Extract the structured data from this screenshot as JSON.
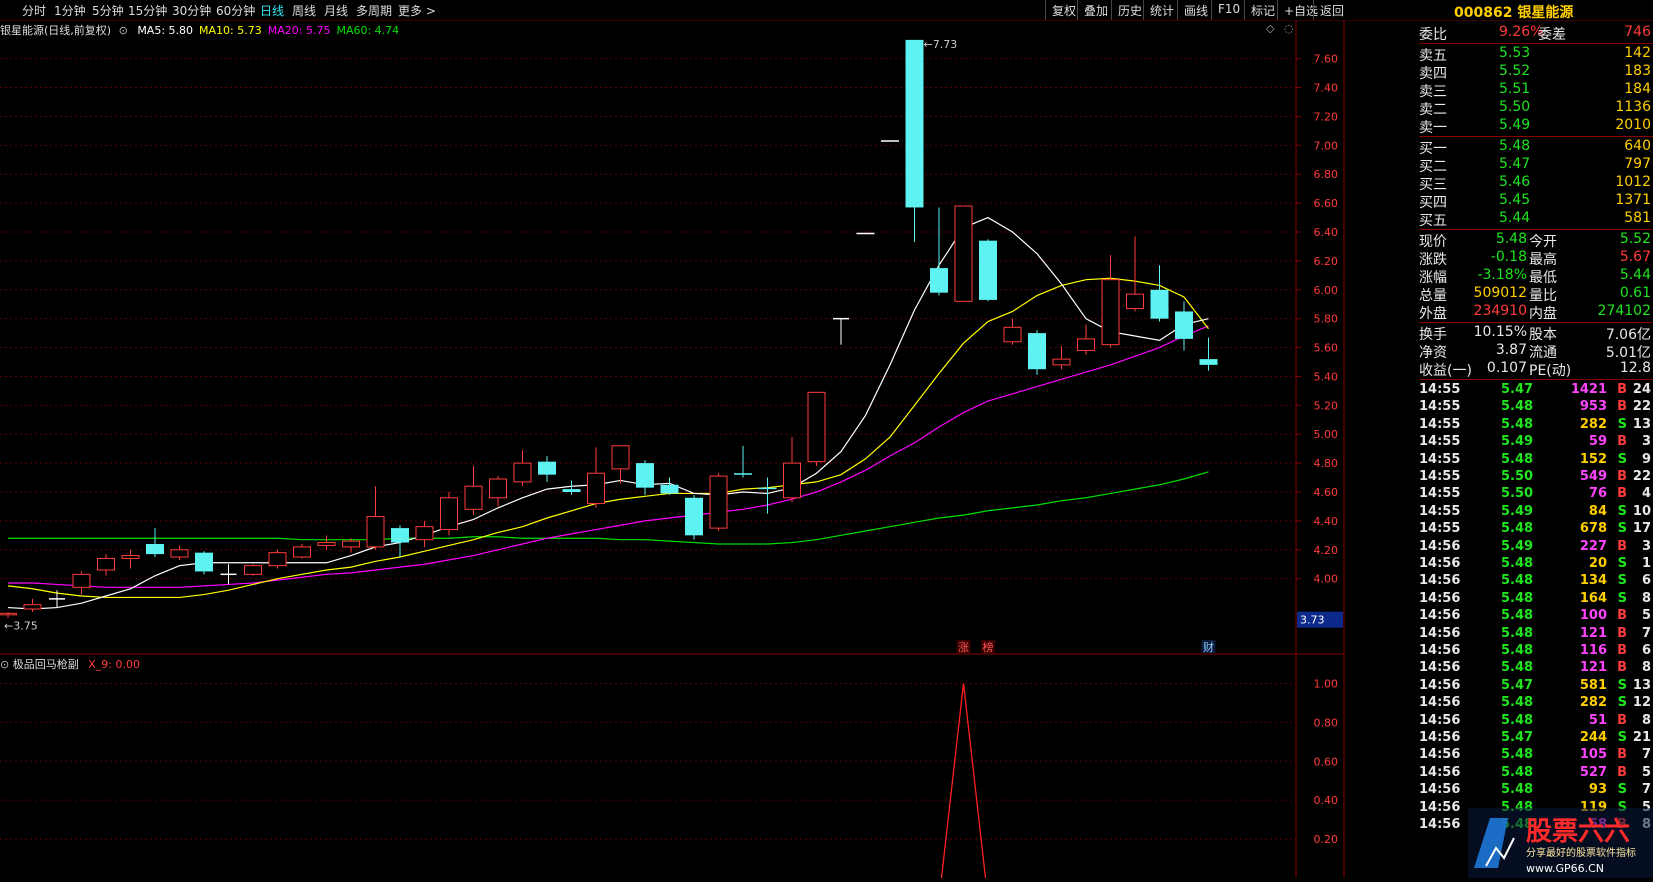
{
  "toolbar": {
    "periods": [
      "分时",
      "1分钟",
      "5分钟",
      "15分钟",
      "30分钟",
      "60分钟",
      "日线",
      "周线",
      "月线",
      "多周期",
      "更多 >"
    ],
    "active_period": "日线",
    "right_buttons": [
      "复权",
      "叠加",
      "历史",
      "统计",
      "画线",
      "F10",
      "标记",
      "+自选",
      "返回"
    ]
  },
  "stock": {
    "code": "000862",
    "name": "银星能源",
    "header": "000862 银星能源"
  },
  "main_chart": {
    "legend_name": "银星能源(日线,前复权)",
    "ma": [
      {
        "label": "MA5: 5.80",
        "color": "#ffffff"
      },
      {
        "label": "MA10: 5.73",
        "color": "#ffff00"
      },
      {
        "label": "MA20: 5.75",
        "color": "#ff00ff"
      },
      {
        "label": "MA60: 4.74",
        "color": "#00e000"
      }
    ],
    "high_label": "7.73",
    "low_label": "3.75",
    "price_tag": "3.73",
    "markers": [
      "涨",
      "榜",
      "财"
    ]
  },
  "sub_chart": {
    "legend_name": "极品回马枪副",
    "legend_value": "X_9: 0.00"
  },
  "chart_data": [
    {
      "type": "candlestick",
      "ylim": [
        3.7,
        7.75
      ],
      "yticks": [
        "7.60",
        "7.40",
        "7.20",
        "7.00",
        "6.80",
        "6.60",
        "6.40",
        "6.20",
        "6.00",
        "5.80",
        "5.60",
        "5.40",
        "5.20",
        "5.00",
        "4.80",
        "4.60",
        "4.40",
        "4.20",
        "4.00"
      ],
      "candles": [
        {
          "o": 3.75,
          "c": 3.76,
          "h": 3.77,
          "l": 3.73
        },
        {
          "o": 3.79,
          "c": 3.82,
          "h": 3.86,
          "l": 3.77
        },
        {
          "o": 3.86,
          "c": 3.86,
          "h": 3.92,
          "l": 3.8
        },
        {
          "o": 3.94,
          "c": 4.03,
          "h": 4.05,
          "l": 3.89
        },
        {
          "o": 4.06,
          "c": 4.14,
          "h": 4.17,
          "l": 4.02
        },
        {
          "o": 4.14,
          "c": 4.16,
          "h": 4.2,
          "l": 4.07
        },
        {
          "o": 4.24,
          "c": 4.17,
          "h": 4.35,
          "l": 4.15
        },
        {
          "o": 4.15,
          "c": 4.2,
          "h": 4.23,
          "l": 4.13
        },
        {
          "o": 4.18,
          "c": 4.05,
          "h": 4.19,
          "l": 4.03
        },
        {
          "o": 4.03,
          "c": 4.03,
          "h": 4.1,
          "l": 3.96
        },
        {
          "o": 4.03,
          "c": 4.09,
          "h": 4.1,
          "l": 4.02
        },
        {
          "o": 4.09,
          "c": 4.18,
          "h": 4.2,
          "l": 4.07
        },
        {
          "o": 4.15,
          "c": 4.22,
          "h": 4.24,
          "l": 4.14
        },
        {
          "o": 4.23,
          "c": 4.25,
          "h": 4.3,
          "l": 4.2
        },
        {
          "o": 4.22,
          "c": 4.26,
          "h": 4.28,
          "l": 4.18
        },
        {
          "o": 4.22,
          "c": 4.43,
          "h": 4.64,
          "l": 4.2
        },
        {
          "o": 4.35,
          "c": 4.25,
          "h": 4.37,
          "l": 4.15
        },
        {
          "o": 4.27,
          "c": 4.36,
          "h": 4.4,
          "l": 4.22
        },
        {
          "o": 4.34,
          "c": 4.56,
          "h": 4.6,
          "l": 4.3
        },
        {
          "o": 4.48,
          "c": 4.64,
          "h": 4.78,
          "l": 4.44
        },
        {
          "o": 4.56,
          "c": 4.69,
          "h": 4.71,
          "l": 4.5
        },
        {
          "o": 4.67,
          "c": 4.8,
          "h": 4.89,
          "l": 4.64
        },
        {
          "o": 4.81,
          "c": 4.72,
          "h": 4.85,
          "l": 4.67
        },
        {
          "o": 4.62,
          "c": 4.6,
          "h": 4.68,
          "l": 4.58
        },
        {
          "o": 4.52,
          "c": 4.73,
          "h": 4.91,
          "l": 4.49
        },
        {
          "o": 4.76,
          "c": 4.92,
          "h": 4.92,
          "l": 4.66
        },
        {
          "o": 4.8,
          "c": 4.63,
          "h": 4.82,
          "l": 4.58
        },
        {
          "o": 4.65,
          "c": 4.59,
          "h": 4.7,
          "l": 4.58
        },
        {
          "o": 4.56,
          "c": 4.3,
          "h": 4.58,
          "l": 4.27
        },
        {
          "o": 4.35,
          "c": 4.71,
          "h": 4.73,
          "l": 4.33
        },
        {
          "o": 4.73,
          "c": 4.72,
          "h": 4.92,
          "l": 4.7
        },
        {
          "o": 4.63,
          "c": 4.62,
          "h": 4.7,
          "l": 4.45
        },
        {
          "o": 4.56,
          "c": 4.8,
          "h": 4.98,
          "l": 4.53
        },
        {
          "o": 4.81,
          "c": 5.29,
          "h": 5.29,
          "l": 4.78
        },
        {
          "o": 5.8,
          "c": 5.8,
          "h": 5.8,
          "l": 5.62
        },
        {
          "o": 6.39,
          "c": 6.39,
          "h": 6.39,
          "l": 6.39
        },
        {
          "o": 7.03,
          "c": 7.03,
          "h": 7.03,
          "l": 7.03
        },
        {
          "o": 7.73,
          "c": 6.57,
          "h": 7.73,
          "l": 6.33
        },
        {
          "o": 6.15,
          "c": 5.98,
          "h": 6.57,
          "l": 5.96
        },
        {
          "o": 5.92,
          "c": 6.58,
          "h": 6.58,
          "l": 5.92
        },
        {
          "o": 6.34,
          "c": 5.93,
          "h": 6.35,
          "l": 5.92
        },
        {
          "o": 5.64,
          "c": 5.74,
          "h": 5.8,
          "l": 5.62
        },
        {
          "o": 5.7,
          "c": 5.45,
          "h": 5.72,
          "l": 5.41
        },
        {
          "o": 5.48,
          "c": 5.52,
          "h": 5.61,
          "l": 5.45
        },
        {
          "o": 5.58,
          "c": 5.66,
          "h": 5.76,
          "l": 5.55
        },
        {
          "o": 5.62,
          "c": 6.07,
          "h": 6.24,
          "l": 5.6
        },
        {
          "o": 5.87,
          "c": 5.97,
          "h": 6.37,
          "l": 5.85
        },
        {
          "o": 6.0,
          "c": 5.8,
          "h": 6.17,
          "l": 5.78
        },
        {
          "o": 5.85,
          "c": 5.66,
          "h": 5.92,
          "l": 5.58
        },
        {
          "o": 5.52,
          "c": 5.48,
          "h": 5.67,
          "l": 5.44
        }
      ],
      "ma5": [
        3.8,
        3.79,
        3.8,
        3.83,
        3.88,
        3.93,
        4.02,
        4.09,
        4.11,
        4.11,
        4.11,
        4.11,
        4.11,
        4.11,
        4.16,
        4.22,
        4.25,
        4.3,
        4.36,
        4.41,
        4.49,
        4.56,
        4.62,
        4.64,
        4.65,
        4.68,
        4.65,
        4.66,
        4.59,
        4.58,
        4.6,
        4.59,
        4.63,
        4.73,
        4.88,
        5.13,
        5.48,
        5.86,
        6.17,
        6.43,
        6.5,
        6.4,
        6.25,
        6.04,
        5.8,
        5.71,
        5.68,
        5.65,
        5.76,
        5.8
      ],
      "ma10": [
        3.95,
        3.93,
        3.9,
        3.88,
        3.87,
        3.87,
        3.87,
        3.87,
        3.89,
        3.92,
        3.96,
        4.0,
        4.03,
        4.06,
        4.08,
        4.12,
        4.15,
        4.19,
        4.23,
        4.27,
        4.32,
        4.36,
        4.42,
        4.47,
        4.52,
        4.55,
        4.57,
        4.59,
        4.59,
        4.59,
        4.62,
        4.63,
        4.65,
        4.67,
        4.72,
        4.83,
        4.98,
        5.2,
        5.42,
        5.63,
        5.78,
        5.85,
        5.96,
        6.03,
        6.07,
        6.08,
        6.06,
        6.03,
        5.95,
        5.73
      ],
      "ma20": [
        3.97,
        3.97,
        3.96,
        3.95,
        3.94,
        3.94,
        3.94,
        3.94,
        3.95,
        3.96,
        3.97,
        3.99,
        4.01,
        4.03,
        4.04,
        4.06,
        4.08,
        4.1,
        4.13,
        4.16,
        4.2,
        4.24,
        4.28,
        4.31,
        4.34,
        4.37,
        4.4,
        4.42,
        4.44,
        4.46,
        4.48,
        4.51,
        4.55,
        4.6,
        4.67,
        4.75,
        4.85,
        4.94,
        5.05,
        5.15,
        5.23,
        5.28,
        5.33,
        5.38,
        5.43,
        5.48,
        5.54,
        5.6,
        5.68,
        5.75
      ],
      "ma60": [
        4.28,
        4.28,
        4.28,
        4.28,
        4.28,
        4.28,
        4.28,
        4.28,
        4.28,
        4.28,
        4.28,
        4.28,
        4.27,
        4.27,
        4.27,
        4.27,
        4.28,
        4.28,
        4.28,
        4.29,
        4.29,
        4.28,
        4.28,
        4.28,
        4.28,
        4.27,
        4.27,
        4.26,
        4.25,
        4.24,
        4.24,
        4.24,
        4.25,
        4.27,
        4.3,
        4.33,
        4.36,
        4.39,
        4.42,
        4.44,
        4.47,
        4.49,
        4.51,
        4.54,
        4.56,
        4.59,
        4.62,
        4.65,
        4.69,
        4.74
      ]
    },
    {
      "type": "line",
      "ylim": [
        0,
        1.1
      ],
      "yticks": [
        "1.00",
        "0.80",
        "0.60",
        "0.40",
        "0.20"
      ],
      "spike_index": 39,
      "spike_value": 1.0
    }
  ],
  "quote_panel": {
    "weibi": {
      "label": "委比",
      "value": "9.26%",
      "label2": "委差",
      "value2": "746"
    },
    "asks": [
      {
        "label": "卖五",
        "price": "5.53",
        "vol": "142"
      },
      {
        "label": "卖四",
        "price": "5.52",
        "vol": "183"
      },
      {
        "label": "卖三",
        "price": "5.51",
        "vol": "184"
      },
      {
        "label": "卖二",
        "price": "5.50",
        "vol": "1136"
      },
      {
        "label": "卖一",
        "price": "5.49",
        "vol": "2010"
      }
    ],
    "bids": [
      {
        "label": "买一",
        "price": "5.48",
        "vol": "640"
      },
      {
        "label": "买二",
        "price": "5.47",
        "vol": "797"
      },
      {
        "label": "买三",
        "price": "5.46",
        "vol": "1012"
      },
      {
        "label": "买四",
        "price": "5.45",
        "vol": "1371"
      },
      {
        "label": "买五",
        "price": "5.44",
        "vol": "581"
      }
    ],
    "stats": [
      {
        "l1": "现价",
        "v1": "5.48",
        "c1": "#1fe51f",
        "l2": "今开",
        "v2": "5.52",
        "c2": "#1fe51f"
      },
      {
        "l1": "涨跌",
        "v1": "-0.18",
        "c1": "#1fe51f",
        "l2": "最高",
        "v2": "5.67",
        "c2": "#ff3b3b"
      },
      {
        "l1": "涨幅",
        "v1": "-3.18%",
        "c1": "#1fe51f",
        "l2": "最低",
        "v2": "5.44",
        "c2": "#1fe51f"
      },
      {
        "l1": "总量",
        "v1": "509012",
        "c1": "#ffcf00",
        "l2": "量比",
        "v2": "0.61",
        "c2": "#1fe51f"
      },
      {
        "l1": "外盘",
        "v1": "234910",
        "c1": "#ff3b3b",
        "l2": "内盘",
        "v2": "274102",
        "c2": "#1fe51f"
      }
    ],
    "stats2": [
      {
        "l1": "换手",
        "v1": "10.15%",
        "l2": "股本",
        "v2": "7.06亿"
      },
      {
        "l1": "净资",
        "v1": "3.87",
        "l2": "流通",
        "v2": "5.01亿"
      },
      {
        "l1": "收益(一)",
        "v1": "0.107",
        "l2": "PE(动)",
        "v2": "12.8"
      }
    ],
    "trades": [
      {
        "t": "14:55",
        "p": "5.47",
        "v": "1421",
        "d": "B",
        "n": "24"
      },
      {
        "t": "14:55",
        "p": "5.48",
        "v": "953",
        "d": "B",
        "n": "22"
      },
      {
        "t": "14:55",
        "p": "5.48",
        "v": "282",
        "d": "S",
        "n": "13"
      },
      {
        "t": "14:55",
        "p": "5.49",
        "v": "59",
        "d": "B",
        "n": "3"
      },
      {
        "t": "14:55",
        "p": "5.48",
        "v": "152",
        "d": "S",
        "n": "9"
      },
      {
        "t": "14:55",
        "p": "5.50",
        "v": "549",
        "d": "B",
        "n": "22"
      },
      {
        "t": "14:55",
        "p": "5.50",
        "v": "76",
        "d": "B",
        "n": "4"
      },
      {
        "t": "14:55",
        "p": "5.49",
        "v": "84",
        "d": "S",
        "n": "10"
      },
      {
        "t": "14:55",
        "p": "5.48",
        "v": "678",
        "d": "S",
        "n": "17"
      },
      {
        "t": "14:56",
        "p": "5.49",
        "v": "227",
        "d": "B",
        "n": "3"
      },
      {
        "t": "14:56",
        "p": "5.48",
        "v": "20",
        "d": "S",
        "n": "1"
      },
      {
        "t": "14:56",
        "p": "5.48",
        "v": "134",
        "d": "S",
        "n": "6"
      },
      {
        "t": "14:56",
        "p": "5.48",
        "v": "164",
        "d": "S",
        "n": "8"
      },
      {
        "t": "14:56",
        "p": "5.48",
        "v": "100",
        "d": "B",
        "n": "5"
      },
      {
        "t": "14:56",
        "p": "5.48",
        "v": "121",
        "d": "B",
        "n": "7"
      },
      {
        "t": "14:56",
        "p": "5.48",
        "v": "116",
        "d": "B",
        "n": "6"
      },
      {
        "t": "14:56",
        "p": "5.48",
        "v": "121",
        "d": "B",
        "n": "8"
      },
      {
        "t": "14:56",
        "p": "5.47",
        "v": "581",
        "d": "S",
        "n": "13"
      },
      {
        "t": "14:56",
        "p": "5.48",
        "v": "282",
        "d": "S",
        "n": "12"
      },
      {
        "t": "14:56",
        "p": "5.48",
        "v": "51",
        "d": "B",
        "n": "8"
      },
      {
        "t": "14:56",
        "p": "5.47",
        "v": "244",
        "d": "S",
        "n": "21"
      },
      {
        "t": "14:56",
        "p": "5.48",
        "v": "105",
        "d": "B",
        "n": "7"
      },
      {
        "t": "14:56",
        "p": "5.48",
        "v": "527",
        "d": "B",
        "n": "5"
      },
      {
        "t": "14:56",
        "p": "5.48",
        "v": "93",
        "d": "S",
        "n": "7"
      },
      {
        "t": "14:56",
        "p": "5.48",
        "v": "119",
        "d": "S",
        "n": "5"
      },
      {
        "t": "14:56",
        "p": "5.48",
        "v": "68",
        "d": "B",
        "n": "8"
      }
    ]
  },
  "watermark": {
    "title": "股票六六",
    "subtitle": "分享最好的股票软件指标",
    "url": "www.GP66.CN"
  },
  "colors": {
    "up": "#ff3b3b",
    "down": "#5ef2f2",
    "bg": "#000000",
    "grid": "#5a0000",
    "ma5": "#ffffff",
    "ma10": "#ffff00",
    "ma20": "#ff00ff",
    "ma60": "#00e000"
  }
}
